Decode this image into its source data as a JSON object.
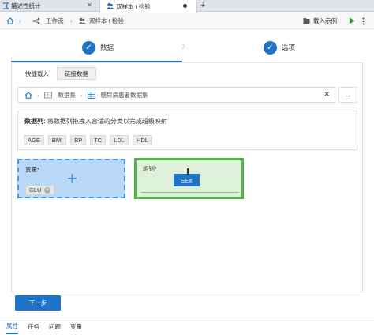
{
  "tabs": [
    {
      "label": "描述性统计",
      "icon": "stats-icon"
    },
    {
      "label": "双样本 t 检验",
      "icon": "users-icon"
    }
  ],
  "toolbar": {
    "breadcrumb": [
      "工作流",
      "双样本 t 检验"
    ],
    "import_example": "载入示例"
  },
  "steps": [
    {
      "label": "数据",
      "active": true
    },
    {
      "label": "选项",
      "active": false
    }
  ],
  "subtabs": [
    "快捷载入",
    "链接数据"
  ],
  "dataset_path": [
    "数据集",
    "糖尿病患者数据集"
  ],
  "variables": {
    "title_bold": "数据列:",
    "title_rest": "将数据列拖拽入合适的分类以完成超级映射",
    "items": [
      "AGE",
      "BMI",
      "BP",
      "TC",
      "LDL",
      "HDL"
    ]
  },
  "zones": {
    "variable_label": "变量*",
    "variable_value": "GLU",
    "group_label": "组别*",
    "dragging_item": "SEX"
  },
  "next_button": "下一步",
  "bottom_tabs": [
    "属性",
    "任务",
    "问题",
    "变量"
  ],
  "colors": {
    "accent": "#1e73c8",
    "drop_green": "#4fb548",
    "drop_blue": "#b9d7f7"
  }
}
